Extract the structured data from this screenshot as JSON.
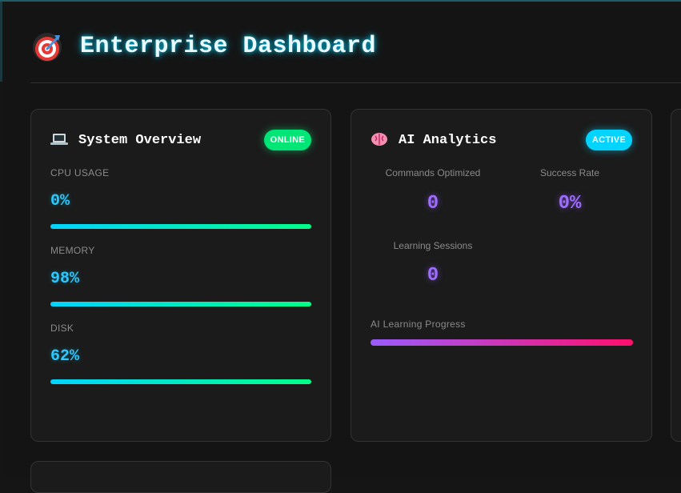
{
  "header": {
    "title": "Enterprise Dashboard",
    "logo_icon": "target-icon"
  },
  "system_overview": {
    "icon": "laptop-icon",
    "title": "System Overview",
    "badge": "ONLINE",
    "metrics": [
      {
        "label": "CPU USAGE",
        "value": "0%",
        "percent": 100
      },
      {
        "label": "MEMORY",
        "value": "98%",
        "percent": 98
      },
      {
        "label": "DISK",
        "value": "62%",
        "percent": 62
      }
    ]
  },
  "ai_analytics": {
    "icon": "brain-icon",
    "title": "AI Analytics",
    "badge": "ACTIVE",
    "stats": [
      {
        "label": "Commands Optimized",
        "value": "0"
      },
      {
        "label": "Success Rate",
        "value": "0%"
      },
      {
        "label": "Learning Sessions",
        "value": "0"
      }
    ],
    "progress_label": "AI Learning Progress",
    "progress_percent": 100
  },
  "colors": {
    "accent_cyan": "#00d4ff",
    "accent_green": "#00e676",
    "accent_purple": "#a06cff",
    "accent_pink": "#ff0f6e"
  }
}
